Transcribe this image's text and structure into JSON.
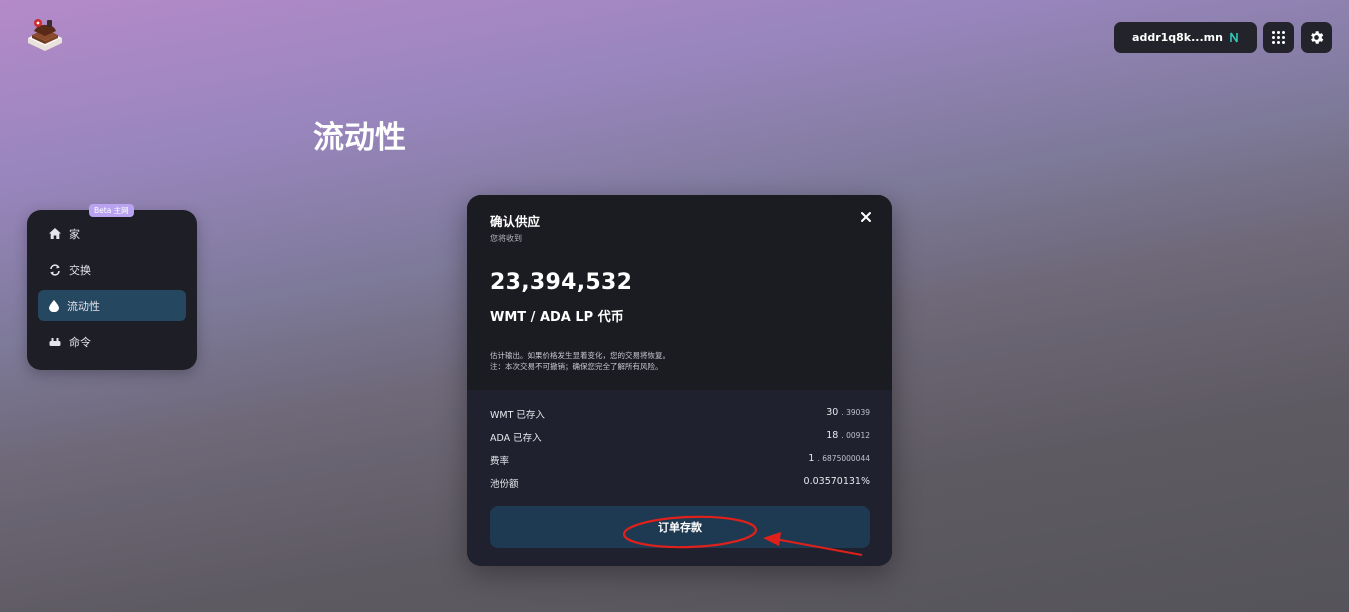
{
  "header": {
    "wallet_address": "addr1q8k...mn",
    "wallet_currency_icon": "ada-icon"
  },
  "page": {
    "title": "流动性"
  },
  "sidebar": {
    "badge": "Beta 主网",
    "items": [
      {
        "label": "家",
        "icon": "home-icon",
        "active": false
      },
      {
        "label": "交换",
        "icon": "swap-icon",
        "active": false
      },
      {
        "label": "流动性",
        "icon": "drop-icon",
        "active": true
      },
      {
        "label": "命令",
        "icon": "orders-icon",
        "active": false
      }
    ]
  },
  "modal": {
    "title": "确认供应",
    "subtitle": "您将收到",
    "amount": "23,394,532",
    "token": "WMT / ADA LP 代币",
    "note_line1": "估计输出。如果价格发生显着变化，您的交易将恢复。",
    "note_line2": "注：本次交易不可撤销；确保您完全了解所有风险。",
    "rows": [
      {
        "label": "WMT 已存入",
        "int": "30",
        "dec": ". 39039"
      },
      {
        "label": "ADA 已存入",
        "int": "18",
        "dec": ". 00912"
      },
      {
        "label": "费率",
        "int": "1",
        "dec": ". 6875000044"
      },
      {
        "label": "池份额",
        "int": "0.03570131%",
        "dec": ""
      }
    ],
    "submit_label": "订单存款"
  },
  "colors": {
    "accent_active": "#254760",
    "button": "#1e3a52",
    "annotation": "#e0211b",
    "beta_badge": "#b9a3f0"
  }
}
